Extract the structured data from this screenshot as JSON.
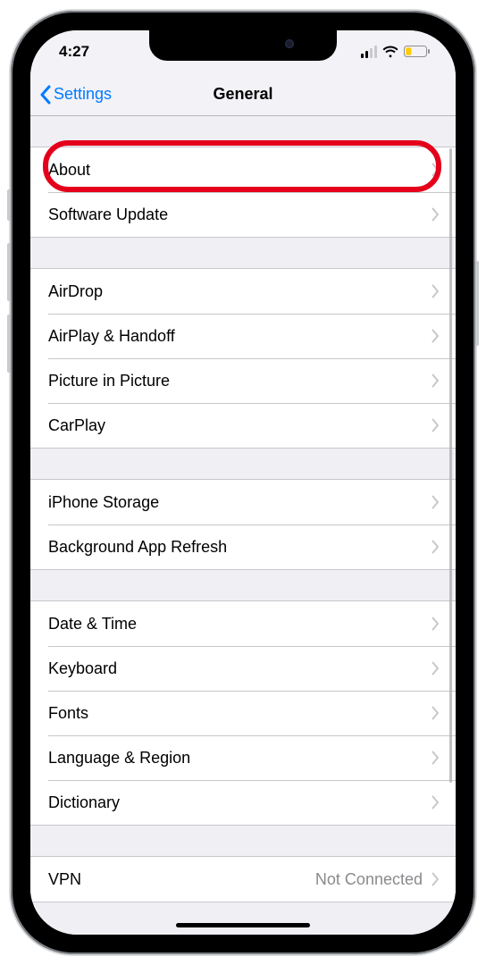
{
  "status": {
    "time": "4:27"
  },
  "navbar": {
    "back_label": "Settings",
    "title": "General"
  },
  "groups": [
    {
      "rows": [
        {
          "key": "about",
          "label": "About"
        },
        {
          "key": "software-update",
          "label": "Software Update"
        }
      ]
    },
    {
      "rows": [
        {
          "key": "airdrop",
          "label": "AirDrop"
        },
        {
          "key": "airplay-handoff",
          "label": "AirPlay & Handoff"
        },
        {
          "key": "picture-in-picture",
          "label": "Picture in Picture"
        },
        {
          "key": "carplay",
          "label": "CarPlay"
        }
      ]
    },
    {
      "rows": [
        {
          "key": "iphone-storage",
          "label": "iPhone Storage"
        },
        {
          "key": "background-app-refresh",
          "label": "Background App Refresh"
        }
      ]
    },
    {
      "rows": [
        {
          "key": "date-time",
          "label": "Date & Time"
        },
        {
          "key": "keyboard",
          "label": "Keyboard"
        },
        {
          "key": "fonts",
          "label": "Fonts"
        },
        {
          "key": "language-region",
          "label": "Language & Region"
        },
        {
          "key": "dictionary",
          "label": "Dictionary"
        }
      ]
    },
    {
      "rows": [
        {
          "key": "vpn",
          "label": "VPN",
          "value": "Not Connected"
        }
      ]
    }
  ],
  "highlight_row": "about"
}
